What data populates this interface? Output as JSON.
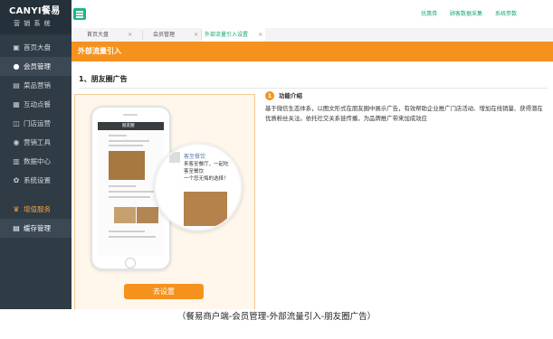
{
  "logo": {
    "main": "CANYI餐易",
    "sub": "营 销 系 统"
  },
  "sidebar": {
    "items": [
      {
        "icon": "home-icon",
        "glyph": "▣",
        "label": "首页大盘"
      },
      {
        "icon": "user-icon",
        "glyph": "●",
        "label": "会员管理",
        "active": true
      },
      {
        "icon": "menu-icon",
        "glyph": "▤",
        "label": "菜品营销"
      },
      {
        "icon": "interact-icon",
        "glyph": "▦",
        "label": "互动点餐"
      },
      {
        "icon": "store-icon",
        "glyph": "◫",
        "label": "门店运营"
      },
      {
        "icon": "chat-icon",
        "glyph": "◉",
        "label": "营销工具"
      },
      {
        "icon": "data-icon",
        "glyph": "▥",
        "label": "数据中心"
      },
      {
        "icon": "gear-icon",
        "glyph": "✿",
        "label": "系统设置"
      },
      {
        "icon": "crown-icon",
        "glyph": "♛",
        "label": "增值服务",
        "orange": true
      },
      {
        "icon": "save-icon",
        "glyph": "▤",
        "label": "缓存管理",
        "active": true
      }
    ]
  },
  "topbar": {
    "links": [
      "优惠券",
      "顾客数据采集",
      "系统参数"
    ]
  },
  "tabs": [
    {
      "label": "首页大盘",
      "close": "×"
    },
    {
      "label": "会员管理",
      "close": "×"
    },
    {
      "label": "外部流量引入设置",
      "close": "×",
      "active": true
    }
  ],
  "content": {
    "header": "外部流量引入",
    "section_title": "1、朋友圈广告",
    "button": "去设置",
    "feature": {
      "icon_text": "1",
      "title": "功能介绍",
      "desc": "基于微信生态体系，以图文形式在朋友圈中展示广告，有效帮助企业推广门店活动、增加在线销量、获得潜在优质粉丝关注。依托社交关系链传播，为品牌推广带来加成效应"
    },
    "preview": {
      "phone_title": "朋友圈",
      "circle_name": "客至餐饮",
      "circle_text": [
        "来客至餐厅，一起吃",
        "客至餐饮",
        "一个您无悔的选择！"
      ],
      "brand": "CANYI 餐易"
    }
  },
  "caption": "（餐易商户端-会员管理-外部流量引入-朋友圈广告）"
}
